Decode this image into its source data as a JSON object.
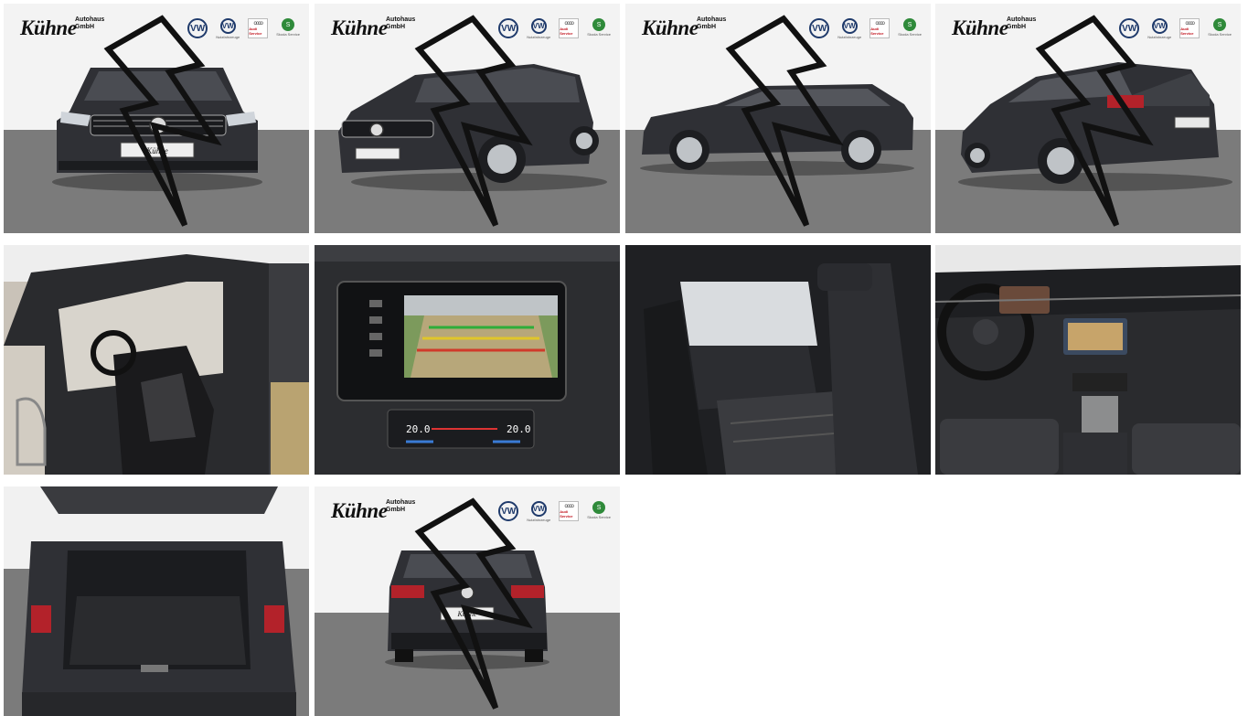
{
  "dealer": {
    "logo_text": "Kühne",
    "logo_sub": "Autohaus GmbH",
    "vw_mark": "VW",
    "vw_nutz_caption": "Nutzfahrzeuge",
    "audi_caption": "Audi Service",
    "skoda_caption": "Skoda Service",
    "skoda_mark": "S"
  },
  "plate_text": "Kühne",
  "dash_temp_left": "20.0",
  "dash_temp_right": "20.0",
  "colors": {
    "car_body": "#2f3035",
    "floor": "#7b7b7b",
    "wall": "#f3f3f3",
    "vw_blue": "#1f3a6b",
    "skoda_green": "#2f8a3a"
  },
  "gallery": [
    {
      "view": "front"
    },
    {
      "view": "front-three-quarter"
    },
    {
      "view": "side"
    },
    {
      "view": "rear-three-quarter"
    },
    {
      "view": "driver-door-interior"
    },
    {
      "view": "infotainment-rear-camera"
    },
    {
      "view": "rear-seats"
    },
    {
      "view": "dashboard"
    },
    {
      "view": "trunk-open"
    },
    {
      "view": "rear"
    }
  ]
}
